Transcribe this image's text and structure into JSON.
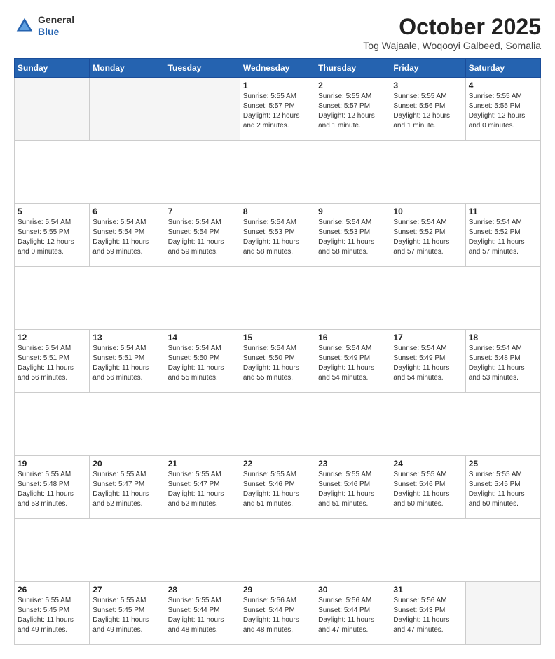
{
  "header": {
    "logo": {
      "general": "General",
      "blue": "Blue"
    },
    "title": "October 2025",
    "location": "Tog Wajaale, Woqooyi Galbeed, Somalia"
  },
  "calendar": {
    "days_of_week": [
      "Sunday",
      "Monday",
      "Tuesday",
      "Wednesday",
      "Thursday",
      "Friday",
      "Saturday"
    ],
    "weeks": [
      {
        "days": [
          {
            "number": "",
            "info": "",
            "empty": true
          },
          {
            "number": "",
            "info": "",
            "empty": true
          },
          {
            "number": "",
            "info": "",
            "empty": true
          },
          {
            "number": "1",
            "info": "Sunrise: 5:55 AM\nSunset: 5:57 PM\nDaylight: 12 hours\nand 2 minutes.",
            "empty": false
          },
          {
            "number": "2",
            "info": "Sunrise: 5:55 AM\nSunset: 5:57 PM\nDaylight: 12 hours\nand 1 minute.",
            "empty": false
          },
          {
            "number": "3",
            "info": "Sunrise: 5:55 AM\nSunset: 5:56 PM\nDaylight: 12 hours\nand 1 minute.",
            "empty": false
          },
          {
            "number": "4",
            "info": "Sunrise: 5:55 AM\nSunset: 5:55 PM\nDaylight: 12 hours\nand 0 minutes.",
            "empty": false
          }
        ]
      },
      {
        "days": [
          {
            "number": "5",
            "info": "Sunrise: 5:54 AM\nSunset: 5:55 PM\nDaylight: 12 hours\nand 0 minutes.",
            "empty": false
          },
          {
            "number": "6",
            "info": "Sunrise: 5:54 AM\nSunset: 5:54 PM\nDaylight: 11 hours\nand 59 minutes.",
            "empty": false
          },
          {
            "number": "7",
            "info": "Sunrise: 5:54 AM\nSunset: 5:54 PM\nDaylight: 11 hours\nand 59 minutes.",
            "empty": false
          },
          {
            "number": "8",
            "info": "Sunrise: 5:54 AM\nSunset: 5:53 PM\nDaylight: 11 hours\nand 58 minutes.",
            "empty": false
          },
          {
            "number": "9",
            "info": "Sunrise: 5:54 AM\nSunset: 5:53 PM\nDaylight: 11 hours\nand 58 minutes.",
            "empty": false
          },
          {
            "number": "10",
            "info": "Sunrise: 5:54 AM\nSunset: 5:52 PM\nDaylight: 11 hours\nand 57 minutes.",
            "empty": false
          },
          {
            "number": "11",
            "info": "Sunrise: 5:54 AM\nSunset: 5:52 PM\nDaylight: 11 hours\nand 57 minutes.",
            "empty": false
          }
        ]
      },
      {
        "days": [
          {
            "number": "12",
            "info": "Sunrise: 5:54 AM\nSunset: 5:51 PM\nDaylight: 11 hours\nand 56 minutes.",
            "empty": false
          },
          {
            "number": "13",
            "info": "Sunrise: 5:54 AM\nSunset: 5:51 PM\nDaylight: 11 hours\nand 56 minutes.",
            "empty": false
          },
          {
            "number": "14",
            "info": "Sunrise: 5:54 AM\nSunset: 5:50 PM\nDaylight: 11 hours\nand 55 minutes.",
            "empty": false
          },
          {
            "number": "15",
            "info": "Sunrise: 5:54 AM\nSunset: 5:50 PM\nDaylight: 11 hours\nand 55 minutes.",
            "empty": false
          },
          {
            "number": "16",
            "info": "Sunrise: 5:54 AM\nSunset: 5:49 PM\nDaylight: 11 hours\nand 54 minutes.",
            "empty": false
          },
          {
            "number": "17",
            "info": "Sunrise: 5:54 AM\nSunset: 5:49 PM\nDaylight: 11 hours\nand 54 minutes.",
            "empty": false
          },
          {
            "number": "18",
            "info": "Sunrise: 5:54 AM\nSunset: 5:48 PM\nDaylight: 11 hours\nand 53 minutes.",
            "empty": false
          }
        ]
      },
      {
        "days": [
          {
            "number": "19",
            "info": "Sunrise: 5:55 AM\nSunset: 5:48 PM\nDaylight: 11 hours\nand 53 minutes.",
            "empty": false
          },
          {
            "number": "20",
            "info": "Sunrise: 5:55 AM\nSunset: 5:47 PM\nDaylight: 11 hours\nand 52 minutes.",
            "empty": false
          },
          {
            "number": "21",
            "info": "Sunrise: 5:55 AM\nSunset: 5:47 PM\nDaylight: 11 hours\nand 52 minutes.",
            "empty": false
          },
          {
            "number": "22",
            "info": "Sunrise: 5:55 AM\nSunset: 5:46 PM\nDaylight: 11 hours\nand 51 minutes.",
            "empty": false
          },
          {
            "number": "23",
            "info": "Sunrise: 5:55 AM\nSunset: 5:46 PM\nDaylight: 11 hours\nand 51 minutes.",
            "empty": false
          },
          {
            "number": "24",
            "info": "Sunrise: 5:55 AM\nSunset: 5:46 PM\nDaylight: 11 hours\nand 50 minutes.",
            "empty": false
          },
          {
            "number": "25",
            "info": "Sunrise: 5:55 AM\nSunset: 5:45 PM\nDaylight: 11 hours\nand 50 minutes.",
            "empty": false
          }
        ]
      },
      {
        "days": [
          {
            "number": "26",
            "info": "Sunrise: 5:55 AM\nSunset: 5:45 PM\nDaylight: 11 hours\nand 49 minutes.",
            "empty": false
          },
          {
            "number": "27",
            "info": "Sunrise: 5:55 AM\nSunset: 5:45 PM\nDaylight: 11 hours\nand 49 minutes.",
            "empty": false
          },
          {
            "number": "28",
            "info": "Sunrise: 5:55 AM\nSunset: 5:44 PM\nDaylight: 11 hours\nand 48 minutes.",
            "empty": false
          },
          {
            "number": "29",
            "info": "Sunrise: 5:56 AM\nSunset: 5:44 PM\nDaylight: 11 hours\nand 48 minutes.",
            "empty": false
          },
          {
            "number": "30",
            "info": "Sunrise: 5:56 AM\nSunset: 5:44 PM\nDaylight: 11 hours\nand 47 minutes.",
            "empty": false
          },
          {
            "number": "31",
            "info": "Sunrise: 5:56 AM\nSunset: 5:43 PM\nDaylight: 11 hours\nand 47 minutes.",
            "empty": false
          },
          {
            "number": "",
            "info": "",
            "empty": true
          }
        ]
      }
    ]
  }
}
